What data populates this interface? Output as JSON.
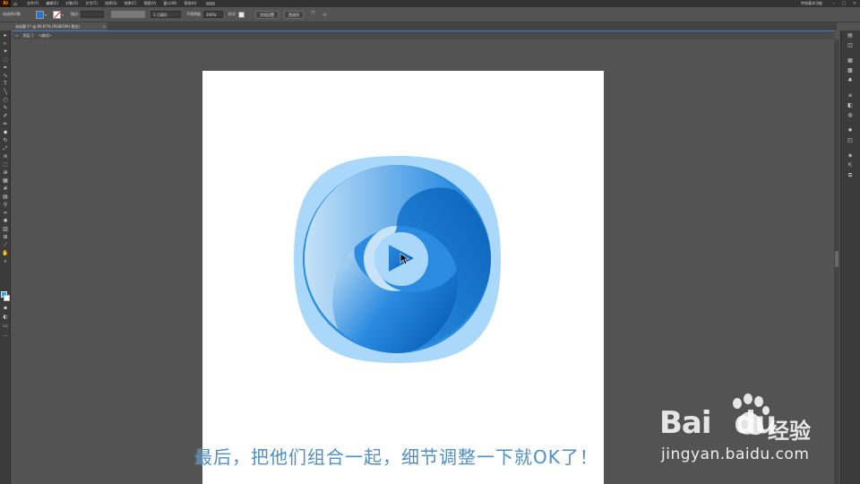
{
  "app": {
    "logo": "Ai",
    "home_icon": "home-icon"
  },
  "menu": {
    "items": [
      "文件(F)",
      "编辑(E)",
      "对象(O)",
      "文字(T)",
      "选择(S)",
      "效果(C)",
      "视图(V)",
      "窗口(W)",
      "帮助(H)"
    ],
    "workspace": "传统基本功能"
  },
  "control": {
    "selection_label": "未选择对象",
    "stroke_label": "描边",
    "brush_value": "3 点圆形",
    "opacity_label": "不透明度",
    "opacity_value": "100%",
    "style_label": "样式",
    "doc_setup_button": "文档设置",
    "prefs_button": "首选项"
  },
  "document": {
    "tab_title": "未标题-1* @ 66.67% (RGB/GPU 预览)",
    "close_icon": "close-icon",
    "breadcrumb": [
      "图层 1",
      "<编组>"
    ]
  },
  "artwork": {
    "colors": {
      "outer": "#a9d8fb",
      "dark": "#0a63b8",
      "mid": "#2b8be0",
      "light": "#c6e3f8",
      "play": "#1a6fd0"
    }
  },
  "caption": {
    "text": "最后，把他们组合一起，细节调整一下就OK了！"
  },
  "watermark": {
    "brand": "Bai",
    "brand_suffix": "du",
    "product": "经验",
    "url": "jingyan.baidu.com"
  }
}
